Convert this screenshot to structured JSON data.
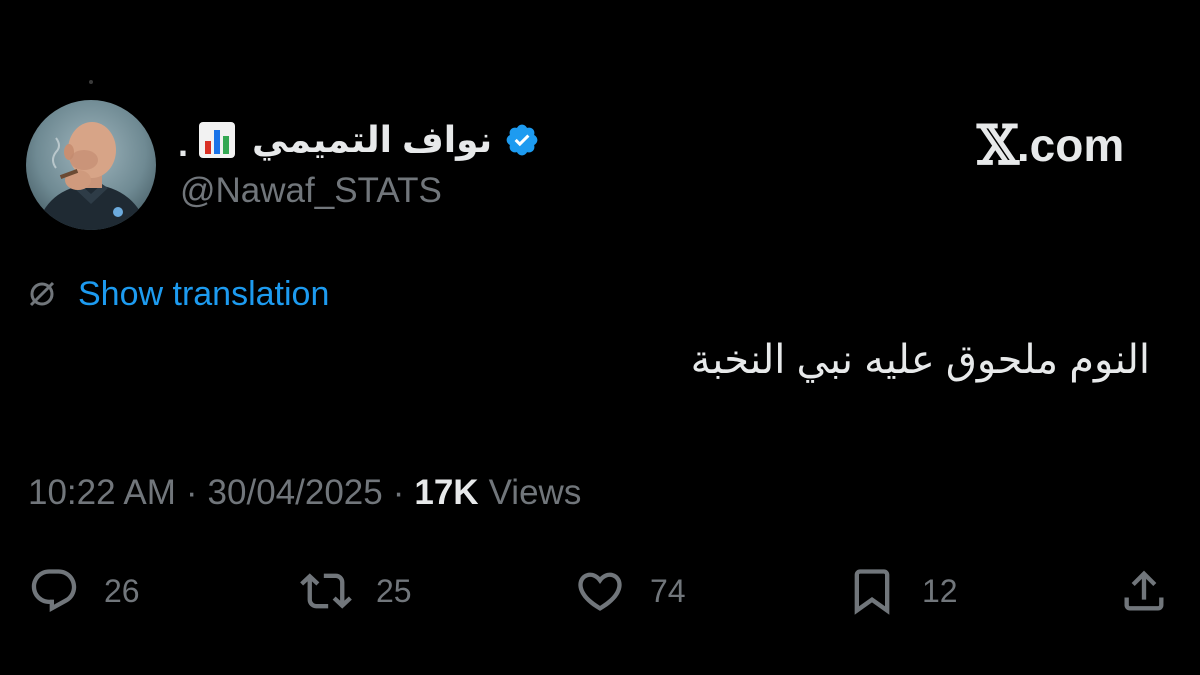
{
  "brand": {
    "label": ".com"
  },
  "author": {
    "display_name": "نواف التميمي",
    "name_suffix": ".",
    "handle": "@Nawaf_STATS",
    "verified": true
  },
  "translation": {
    "label": "Show translation"
  },
  "tweet": {
    "text": "النوم ملحوق عليه نبي النخبة"
  },
  "meta": {
    "time": "10:22 AM",
    "separator": "·",
    "date": "30/04/2025",
    "views_count": "17K",
    "views_label": "Views"
  },
  "actions": {
    "replies": "26",
    "reposts": "25",
    "likes": "74",
    "bookmarks": "12"
  },
  "colors": {
    "background": "#000000",
    "text": "#e7e9ea",
    "secondary": "#71767b",
    "accent": "#1d9bf0"
  },
  "icons": {
    "reply": "speech-bubble-icon",
    "repost": "repost-arrows-icon",
    "like": "heart-icon",
    "bookmark": "bookmark-icon",
    "share": "share-upload-icon",
    "translate": "globe-icon",
    "verified": "verified-badge-icon",
    "stats": "bar-chart-emoji-icon"
  }
}
